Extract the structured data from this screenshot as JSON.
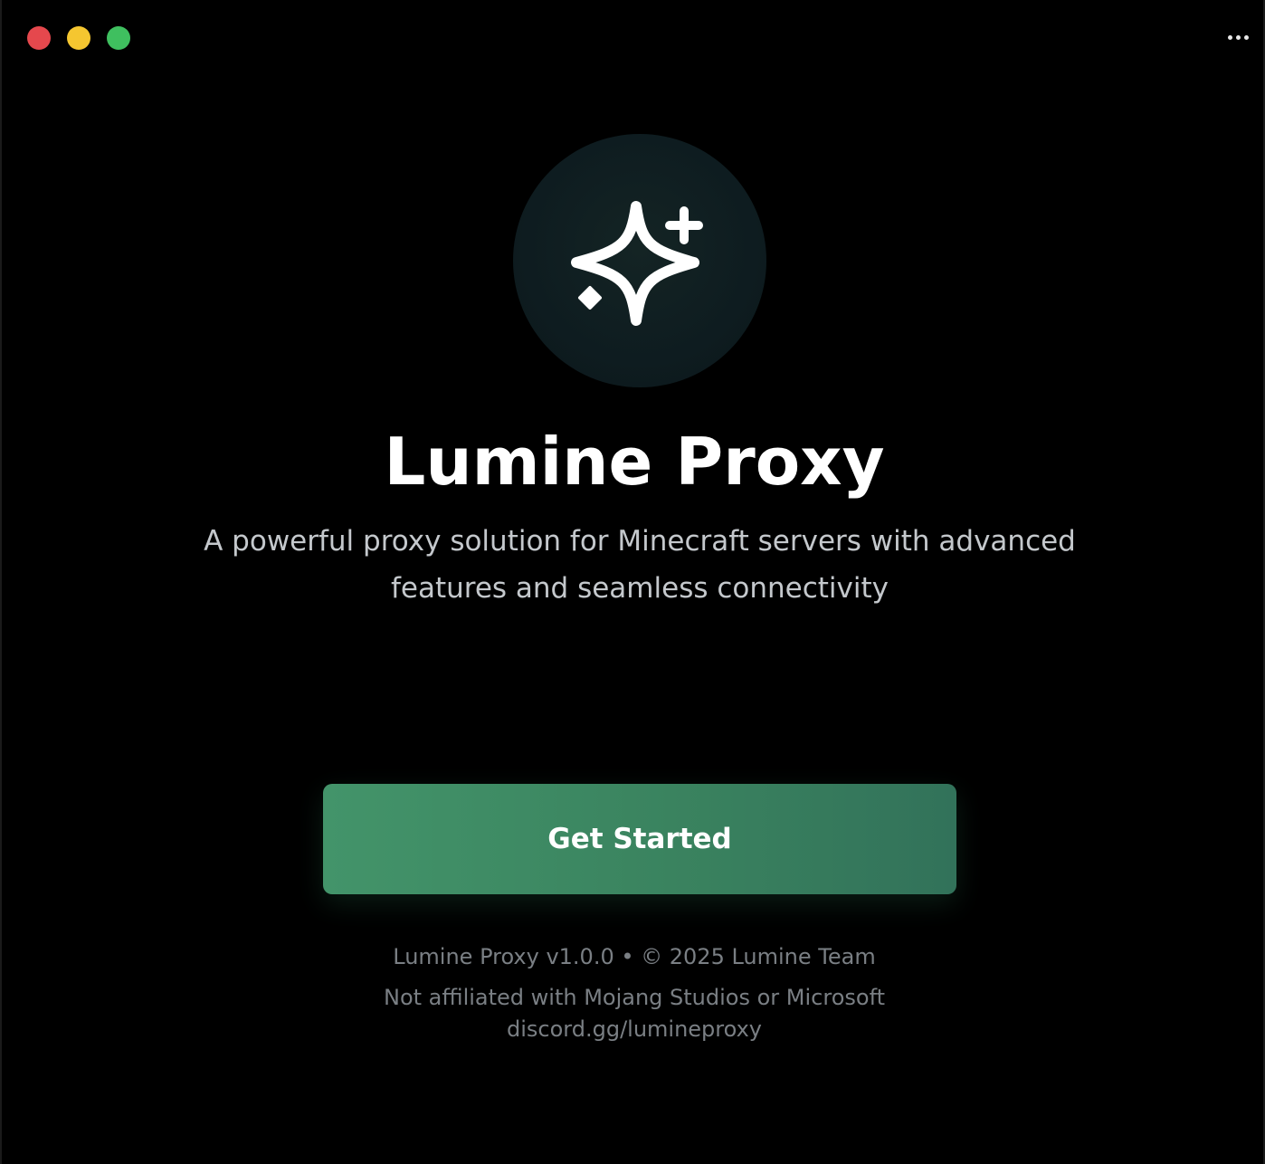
{
  "window": {
    "controls": {
      "close_color": "#e5484d",
      "minimize_color": "#f5c630",
      "maximize_color": "#3fbf5f"
    },
    "menu_icon": "more-dots-icon"
  },
  "logo": {
    "icon": "sparkles-icon"
  },
  "hero": {
    "title": "Lumine Proxy",
    "subtitle": "A powerful proxy solution for Minecraft servers with advanced features and seamless connectivity"
  },
  "cta": {
    "label": "Get Started",
    "color": "#3f8c65"
  },
  "footer": {
    "version_line": "Lumine Proxy v1.0.0 • © 2025 Lumine Team",
    "disclaimer": "Not affiliated with Mojang Studios or Microsoft",
    "discord": "discord.gg/lumineproxy"
  }
}
